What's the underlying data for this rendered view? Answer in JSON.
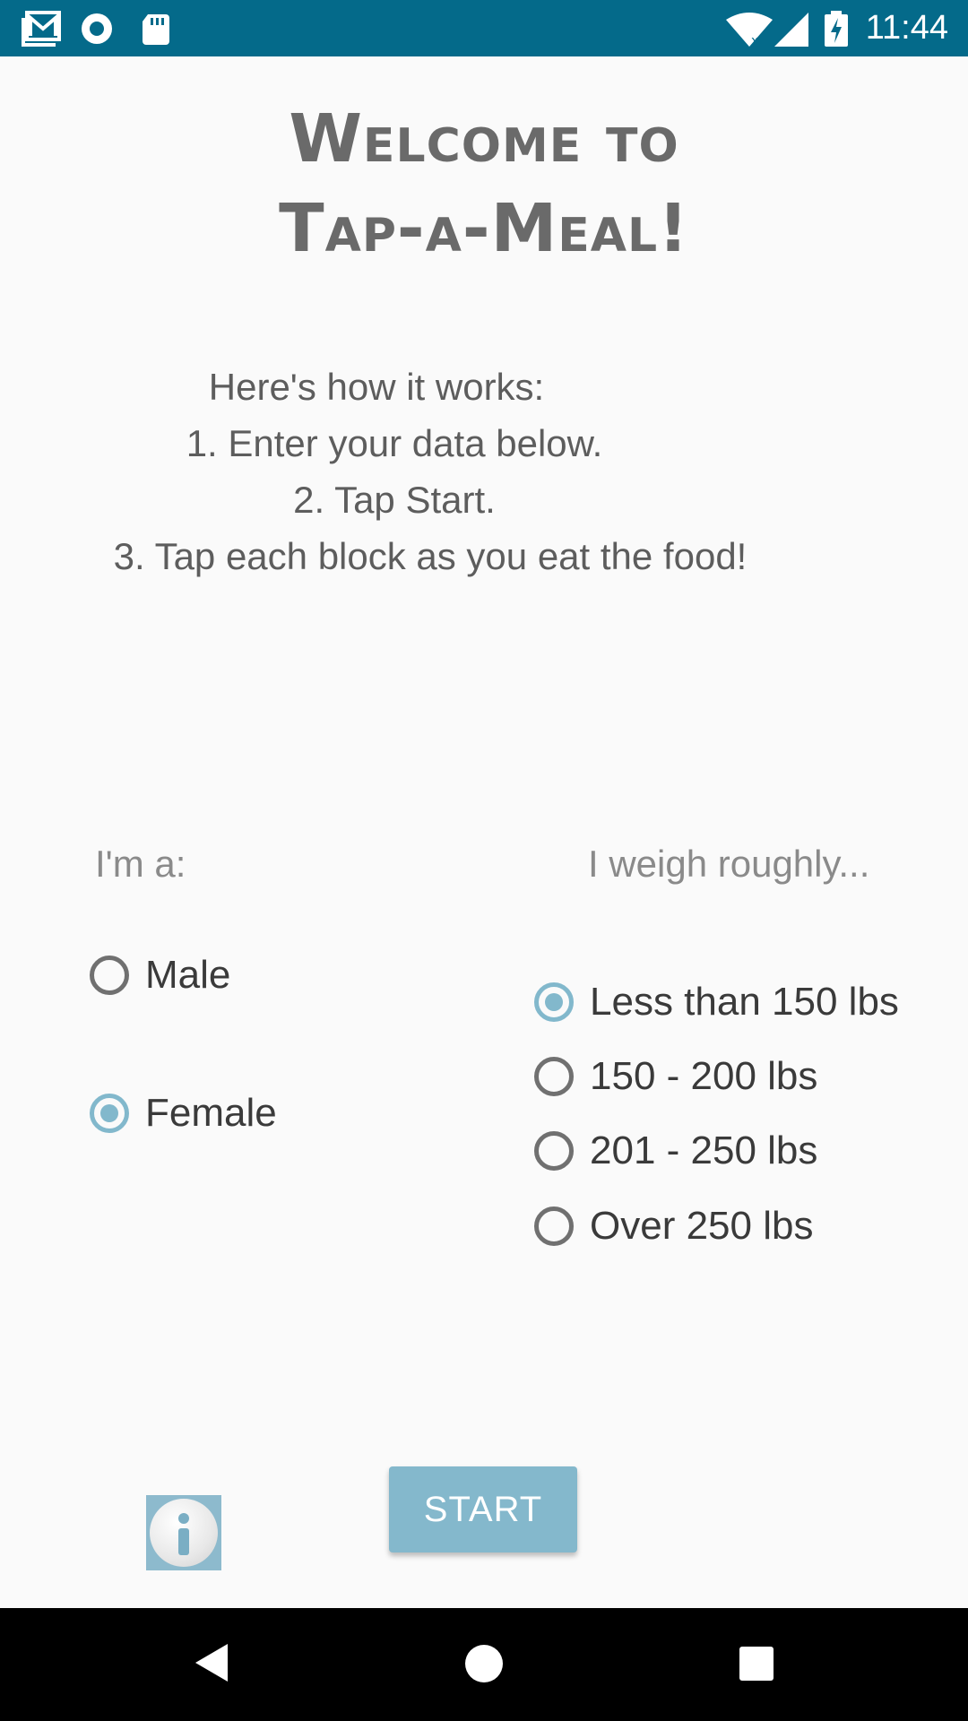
{
  "status_bar": {
    "time": "11:44",
    "icons": [
      "gmail-icon",
      "radio-icon",
      "sd-card-icon",
      "wifi-icon",
      "signal-icon",
      "battery-charging-icon"
    ]
  },
  "header": {
    "title_line1": "Welcome to",
    "title_line2": "Tap-a-Meal!"
  },
  "instructions": {
    "line1": "Here's how it works:",
    "line2": "1. Enter your data below.",
    "line3": "2. Tap Start.",
    "line4": "3. Tap each block as you eat the food!"
  },
  "gender": {
    "label": "I'm a:",
    "options": [
      {
        "label": "Male",
        "checked": false
      },
      {
        "label": "Female",
        "checked": true
      }
    ]
  },
  "weight": {
    "label": "I weigh roughly...",
    "options": [
      {
        "label": "Less than 150 lbs",
        "checked": true
      },
      {
        "label": "150 - 200 lbs",
        "checked": false
      },
      {
        "label": "201 - 250 lbs",
        "checked": false
      },
      {
        "label": "Over 250 lbs",
        "checked": false
      }
    ]
  },
  "actions": {
    "start_label": "START",
    "info_icon": "info-icon"
  },
  "colors": {
    "status_bar": "#046a8a",
    "accent": "#84b8cc",
    "background": "#fafafa"
  }
}
